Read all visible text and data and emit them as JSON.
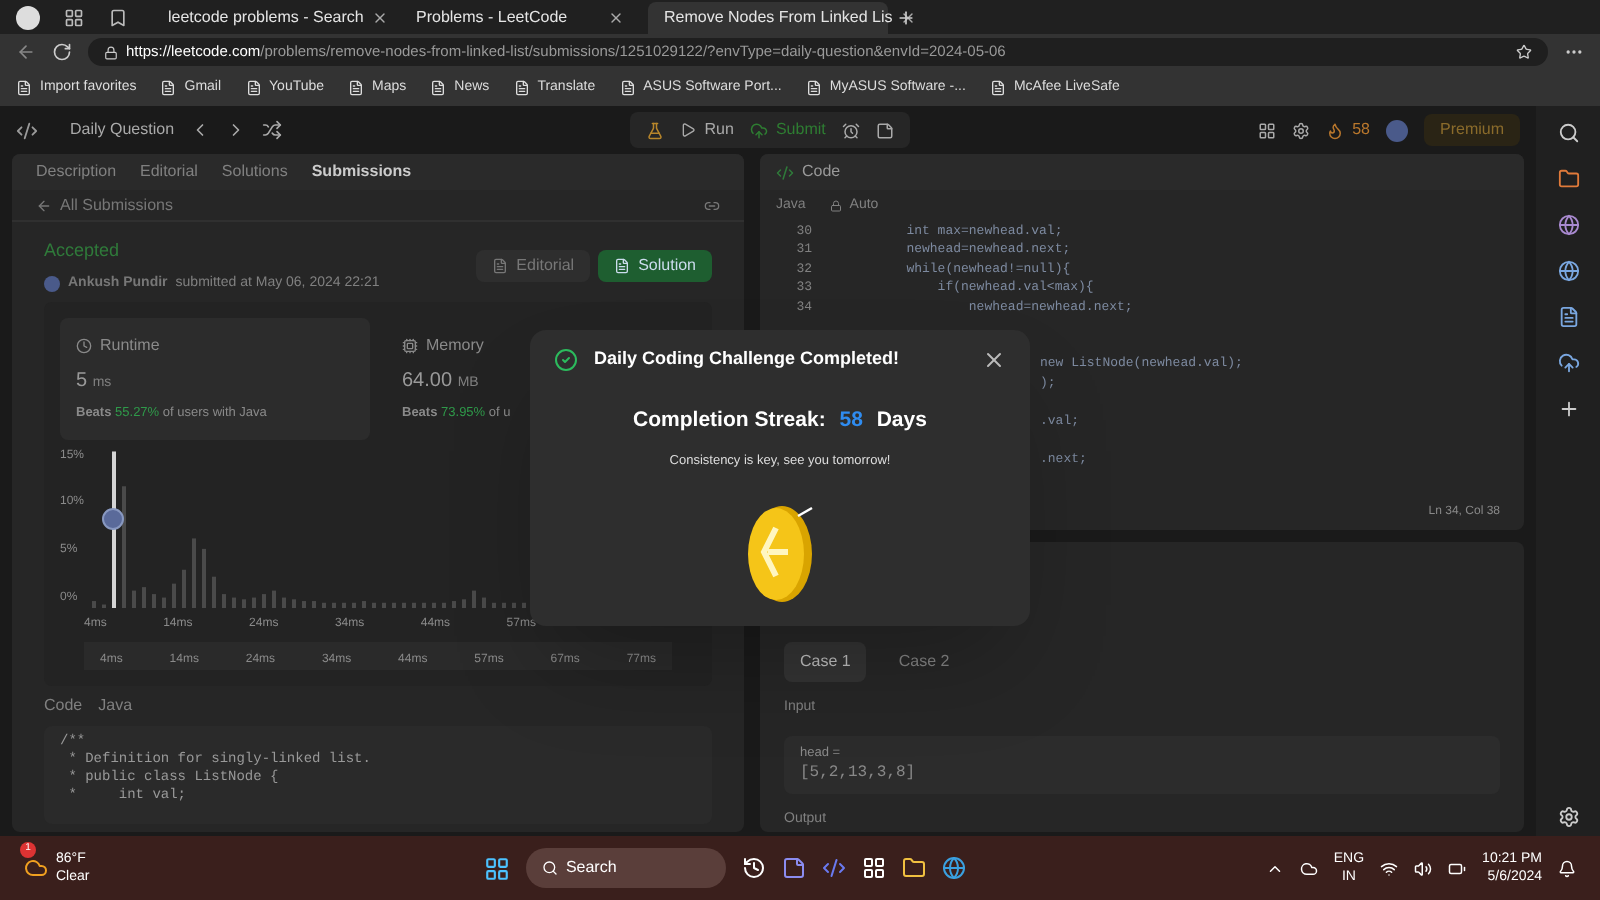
{
  "browser": {
    "tabs": [
      {
        "title": "leetcode problems - Search",
        "selected": false
      },
      {
        "title": "Problems - LeetCode",
        "selected": false
      },
      {
        "title": "Remove Nodes From Linked Lis",
        "selected": true
      }
    ],
    "url_host": "https://leetcode.com",
    "url_path": "/problems/remove-nodes-from-linked-list/submissions/1251029122/?envType=daily-question&envId=2024-05-06",
    "bookmarks": [
      "Import favorites",
      "Gmail",
      "YouTube",
      "Maps",
      "News",
      "Translate",
      "ASUS Software Port...",
      "MyASUS Software -...",
      "McAfee LiveSafe"
    ]
  },
  "header": {
    "title": "Daily Question",
    "run": "Run",
    "submit": "Submit",
    "streak": "58",
    "premium": "Premium"
  },
  "left_tabs": [
    {
      "label": "Description",
      "selected": false
    },
    {
      "label": "Editorial",
      "selected": false
    },
    {
      "label": "Solutions",
      "selected": false
    },
    {
      "label": "Submissions",
      "selected": true
    }
  ],
  "back_link": "All Submissions",
  "submission": {
    "status": "Accepted",
    "user": "Ankush Pundir",
    "submitted": "submitted at May 06, 2024 22:21",
    "editorial": "Editorial",
    "solution": "Solution"
  },
  "runtime": {
    "label": "Runtime",
    "value": "5",
    "unit": "ms",
    "beats": "Beats",
    "percent": "55.27%",
    "suffix": "of users with Java"
  },
  "memory": {
    "label": "Memory",
    "value": "64.00",
    "unit": "MB",
    "beats": "Beats",
    "percent": "73.95%",
    "suffix": "of u"
  },
  "chart": {
    "y_ticks": [
      "15%",
      "10%",
      "5%",
      "0%"
    ],
    "x_ticks": [
      "4ms",
      "14ms",
      "24ms",
      "34ms",
      "44ms",
      "57ms"
    ],
    "overview_ticks": [
      "4ms",
      "14ms",
      "24ms",
      "34ms",
      "44ms",
      "57ms",
      "67ms",
      "77ms"
    ]
  },
  "left_code": {
    "label": "Code",
    "language": "Java",
    "lines": [
      "/**",
      " * Definition for singly-linked list.",
      " * public class ListNode {",
      " *     int val;"
    ]
  },
  "editor": {
    "title": "Code",
    "language": "Java",
    "mode": "Auto",
    "cursor": "Ln 34, Col 38",
    "lines": [
      {
        "kind": "full",
        "number": "30",
        "text": "        int max=newhead.val;"
      },
      {
        "kind": "full",
        "number": "31",
        "text": "        newhead=newhead.next;"
      },
      {
        "kind": "full",
        "number": "32",
        "text": "        while(newhead!=null){"
      },
      {
        "kind": "full",
        "number": "33",
        "text": "            if(newhead.val<max){"
      },
      {
        "kind": "full",
        "number": "34",
        "text": "                newhead=newhead.next;"
      },
      {
        "kind": "blank"
      },
      {
        "kind": "blank"
      },
      {
        "kind": "fragment",
        "text": "new ListNode(newhead.val);"
      },
      {
        "kind": "fragment",
        "text": ");"
      },
      {
        "kind": "blank"
      },
      {
        "kind": "fragment",
        "text": ".val;"
      },
      {
        "kind": "blank"
      },
      {
        "kind": "fragment",
        "text": ".next;"
      }
    ]
  },
  "testcase": {
    "cases": [
      {
        "label": "Case 1",
        "selected": true
      },
      {
        "label": "Case 2",
        "selected": false
      }
    ],
    "input_label": "Input",
    "param": "head =",
    "value": "[5,2,13,3,8]",
    "output_label": "Output"
  },
  "modal": {
    "title": "Daily Coding Challenge Completed!",
    "streak_label": "Completion Streak:",
    "streak": "58",
    "days": "Days",
    "message": "Consistency is key, see you tomorrow!"
  },
  "taskbar": {
    "weather_badge": "1",
    "temperature": "86°F",
    "condition": "Clear",
    "search": "Search",
    "lang": "ENG",
    "region": "IN",
    "time": "10:21 PM",
    "date": "5/6/2024"
  }
}
